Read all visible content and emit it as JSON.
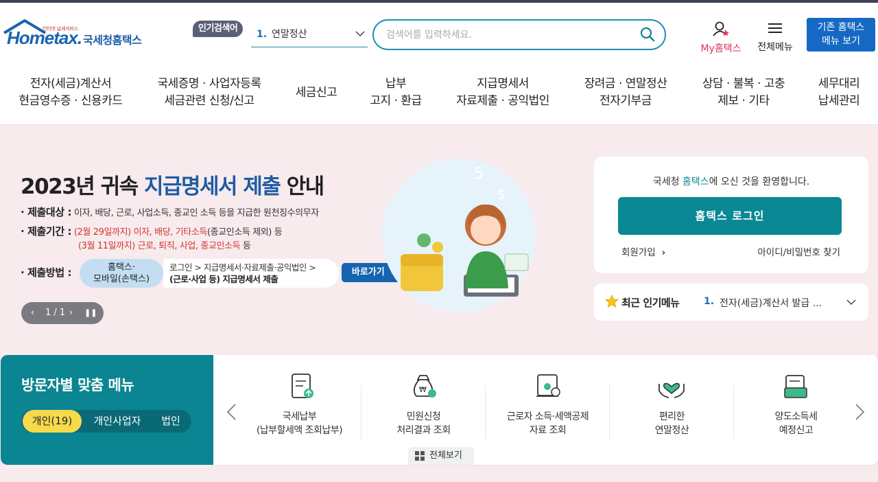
{
  "colors": {
    "brand_blue": "#1569c4",
    "teal": "#0a8894",
    "hero_bg": "#f8ebed",
    "accent_red": "#d2342b",
    "highlight_yellow": "#f7d94c"
  },
  "header": {
    "logo": {
      "tagline": "인터넷 납세서비스",
      "brand": "Hometax.",
      "brand_kr": "국세청홈택스"
    },
    "popular_label": "인기검색어",
    "popular_rank": "1.",
    "popular_term": "연말정산",
    "search_placeholder": "검색어를 입력하세요.",
    "my_hometax": "My홈택스",
    "all_menu": "전체메뉴",
    "old_menu_line1": "기존 홈택스",
    "old_menu_line2": "메뉴 보기"
  },
  "gnb": [
    {
      "line1": "전자(세금)계산서",
      "line2": "현금영수증 · 신용카드"
    },
    {
      "line1": "국세증명 · 사업자등록",
      "line2": "세금관련 신청/신고"
    },
    {
      "line1": "세금신고",
      "line2": ""
    },
    {
      "line1": "납부",
      "line2": "고지 · 환급"
    },
    {
      "line1": "지급명세서",
      "line2": "자료제출 · 공익법인"
    },
    {
      "line1": "장려금 · 연말정산",
      "line2": "전자기부금"
    },
    {
      "line1": "상담 · 불복 · 고충",
      "line2": "제보 · 기타"
    },
    {
      "line1": "세무대리",
      "line2": "납세관리"
    }
  ],
  "banner": {
    "title_pre": "2023년 귀속 ",
    "title_hl": "지급명세서 제출",
    "title_post": " 안내",
    "target_key": "제출대상 :",
    "target_text": "이자, 배당, 근로, 사업소득, 종교인 소득 등을 지급한 원천징수의무자",
    "period_key": "제출기간 :",
    "period1_date": "(2월 29일까지)",
    "period1_items": "이자, 배당, 기타소득",
    "period1_note": "(종교인소득 제외) 등",
    "period2_date": "(3월 11일까지)",
    "period2_items": "근로, 퇴직, 사업, 종교인소득",
    "period2_note": " 등",
    "method_key": "제출방법 :",
    "method_pill_line1": "홈택스·",
    "method_pill_line2": "모바일(손택스)",
    "method_path_line1": "로그인 > 지급명세서·자료제출·공익법인 >",
    "method_path_line2": "(근로·사업 등) 지급명세서 제출",
    "go_button": "바로가기",
    "pager": "1 / 1"
  },
  "login": {
    "welcome_pre": "국세청 ",
    "welcome_hl": "홈택스",
    "welcome_post": "에 오신 것을 환영합니다.",
    "login_button": "홈택스 로그인",
    "join": "회원가입",
    "find": "아이디/비밀번호 찾기"
  },
  "recent": {
    "title": "최근 인기메뉴",
    "rank": "1.",
    "item": "전자(세금)계산서 발급 ..."
  },
  "visitor": {
    "title": "방문자별 맞춤 메뉴",
    "tabs": [
      "개인(19)",
      "개인사업자",
      "법인"
    ],
    "items": [
      {
        "line1": "국세납부",
        "line2": "(납부할세액 조회납부)",
        "icon": "tax-payment-document-icon"
      },
      {
        "line1": "민원신청",
        "line2": "처리결과 조회",
        "icon": "money-bag-search-icon"
      },
      {
        "line1": "근로자 소득·세액공제",
        "line2": "자료 조회",
        "icon": "deduction-scroll-icon"
      },
      {
        "line1": "편리한",
        "line2": "연말정산",
        "icon": "heart-hands-icon"
      },
      {
        "line1": "양도소득세",
        "line2": "예정신고",
        "icon": "folder-document-icon"
      }
    ],
    "view_all": "전체보기"
  }
}
